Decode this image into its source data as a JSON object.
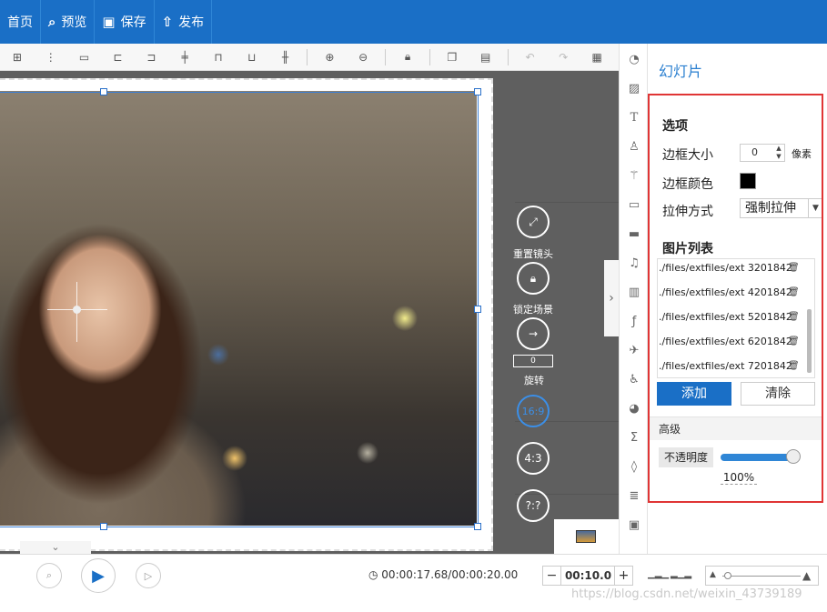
{
  "topbar": {
    "items": [
      {
        "icon": "home-icon",
        "glyph": "",
        "label": "首页"
      },
      {
        "icon": "preview-icon",
        "glyph": "⌕",
        "label": "预览"
      },
      {
        "icon": "save-icon",
        "glyph": "▣",
        "label": "保存"
      },
      {
        "icon": "publish-icon",
        "glyph": "⇧",
        "label": "发布"
      }
    ]
  },
  "toolbar": {
    "icons": [
      "group-icon",
      "ungroup-icon",
      "distribute-h-icon",
      "align-left-icon",
      "align-right-icon",
      "align-center-h-icon",
      "align-top-icon",
      "align-bottom-icon",
      "align-center-v-icon",
      "zoom-in-icon",
      "zoom-out-icon",
      "lock-icon",
      "copy-icon",
      "paste-icon",
      "undo-icon",
      "redo-icon",
      "clear-format-icon"
    ]
  },
  "stage": {
    "controls": {
      "reset_camera_label": "重置镜头",
      "lock_scene_label": "锁定场景",
      "rotate_value": "0",
      "rotate_label": "旋转",
      "ratio_16_9": "16:9",
      "ratio_4_3": "4:3",
      "ratio_custom": "?:?"
    }
  },
  "iconstrip": {
    "icons": [
      "shape-icon",
      "image-icon",
      "text-icon",
      "character-icon",
      "magic-wand-icon",
      "speech-bubble-icon",
      "folder-icon",
      "music-icon",
      "film-icon",
      "formula-icon",
      "airplane-icon",
      "accessibility-icon",
      "pie-chart-icon",
      "sigma-icon",
      "drop-icon",
      "layers-icon",
      "slideshow-icon"
    ]
  },
  "panel": {
    "title": "幻灯片",
    "options_header": "选项",
    "border_size_label": "边框大小",
    "border_size_value": "0",
    "border_size_unit": "像素",
    "border_color_label": "边框颜色",
    "border_color": "#000000",
    "stretch_label": "拉伸方式",
    "stretch_value": "强制拉伸",
    "image_list_header": "图片列表",
    "images": [
      "./files/extfiles/ext  3201842",
      "./files/extfiles/ext  4201842",
      "./files/extfiles/ext  5201842",
      "./files/extfiles/ext  6201842",
      "./files/extfiles/ext  7201842"
    ],
    "add_label": "添加",
    "clear_label": "清除",
    "advanced_label": "高级",
    "opacity_label": "不透明度",
    "opacity_value": "100%",
    "opacity": 1.0
  },
  "bottombar": {
    "time_display": "00:00:17.68/00:00:20.00",
    "duration_value": "00:10.0",
    "watermark": "https://blog.csdn.net/weixin_43739189"
  },
  "colors": {
    "accent": "#1a6fc6",
    "highlight_border": "#e03535"
  }
}
